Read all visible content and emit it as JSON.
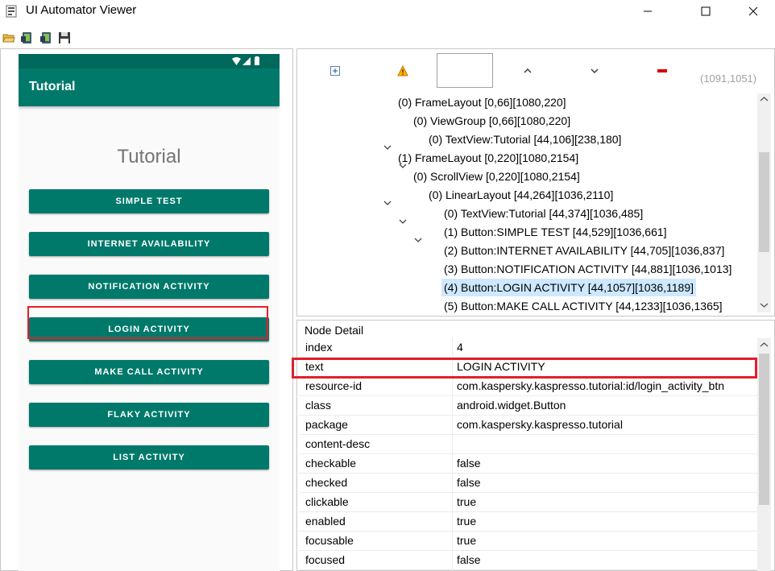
{
  "window": {
    "title": "UI Automator Viewer"
  },
  "device": {
    "appbar_title": "Tutorial",
    "content_title": "Tutorial",
    "buttons": [
      "SIMPLE TEST",
      "INTERNET AVAILABILITY",
      "NOTIFICATION ACTIVITY",
      "LOGIN ACTIVITY",
      "MAKE CALL ACTIVITY",
      "FLAKY ACTIVITY",
      "LIST ACTIVITY"
    ],
    "selected_button": "LOGIN ACTIVITY"
  },
  "hierarchy": {
    "coords": "(1091,1051)",
    "rows": [
      "(0) FrameLayout [0,66][1080,220]",
      "(0) ViewGroup [0,66][1080,220]",
      "(0) TextView:Tutorial [44,106][238,180]",
      "(1) FrameLayout [0,220][1080,2154]",
      "(0) ScrollView [0,220][1080,2154]",
      "(0) LinearLayout [44,264][1036,2110]",
      "(0) TextView:Tutorial [44,374][1036,485]",
      "(1) Button:SIMPLE TEST [44,529][1036,661]",
      "(2) Button:INTERNET AVAILABILITY [44,705][1036,837]",
      "(3) Button:NOTIFICATION ACTIVITY [44,881][1036,1013]",
      "(4) Button:LOGIN ACTIVITY [44,1057][1036,1189]",
      "(5) Button:MAKE CALL ACTIVITY [44,1233][1036,1365]"
    ],
    "selected_row": "(4) Button:LOGIN ACTIVITY [44,1057][1036,1189]"
  },
  "node_detail": {
    "label": "Node Detail",
    "rows": [
      {
        "key": "index",
        "value": "4"
      },
      {
        "key": "text",
        "value": "LOGIN ACTIVITY"
      },
      {
        "key": "resource-id",
        "value": "com.kaspersky.kaspresso.tutorial:id/login_activity_btn"
      },
      {
        "key": "class",
        "value": "android.widget.Button"
      },
      {
        "key": "package",
        "value": "com.kaspersky.kaspresso.tutorial"
      },
      {
        "key": "content-desc",
        "value": ""
      },
      {
        "key": "checkable",
        "value": "false"
      },
      {
        "key": "checked",
        "value": "false"
      },
      {
        "key": "clickable",
        "value": "true"
      },
      {
        "key": "enabled",
        "value": "true"
      },
      {
        "key": "focusable",
        "value": "true"
      },
      {
        "key": "focused",
        "value": "false"
      }
    ],
    "highlighted_key": "resource-id"
  },
  "colors": {
    "accent_teal": "#00796b",
    "status_teal": "#00695c",
    "highlight_red": "#e0202c",
    "selection_blue": "#cde8ff"
  },
  "icons": {
    "open": "folder-open-icon",
    "screenshot": "android-screenshot-icon",
    "screenshot_compressed": "android-screenshot-compressed-icon",
    "save": "floppy-disk-icon",
    "expand_all": "expand-all-icon",
    "warning": "warning-icon",
    "prev": "chevron-up-icon",
    "next": "chevron-down-icon",
    "toggle_naf": "red-bar-icon"
  }
}
